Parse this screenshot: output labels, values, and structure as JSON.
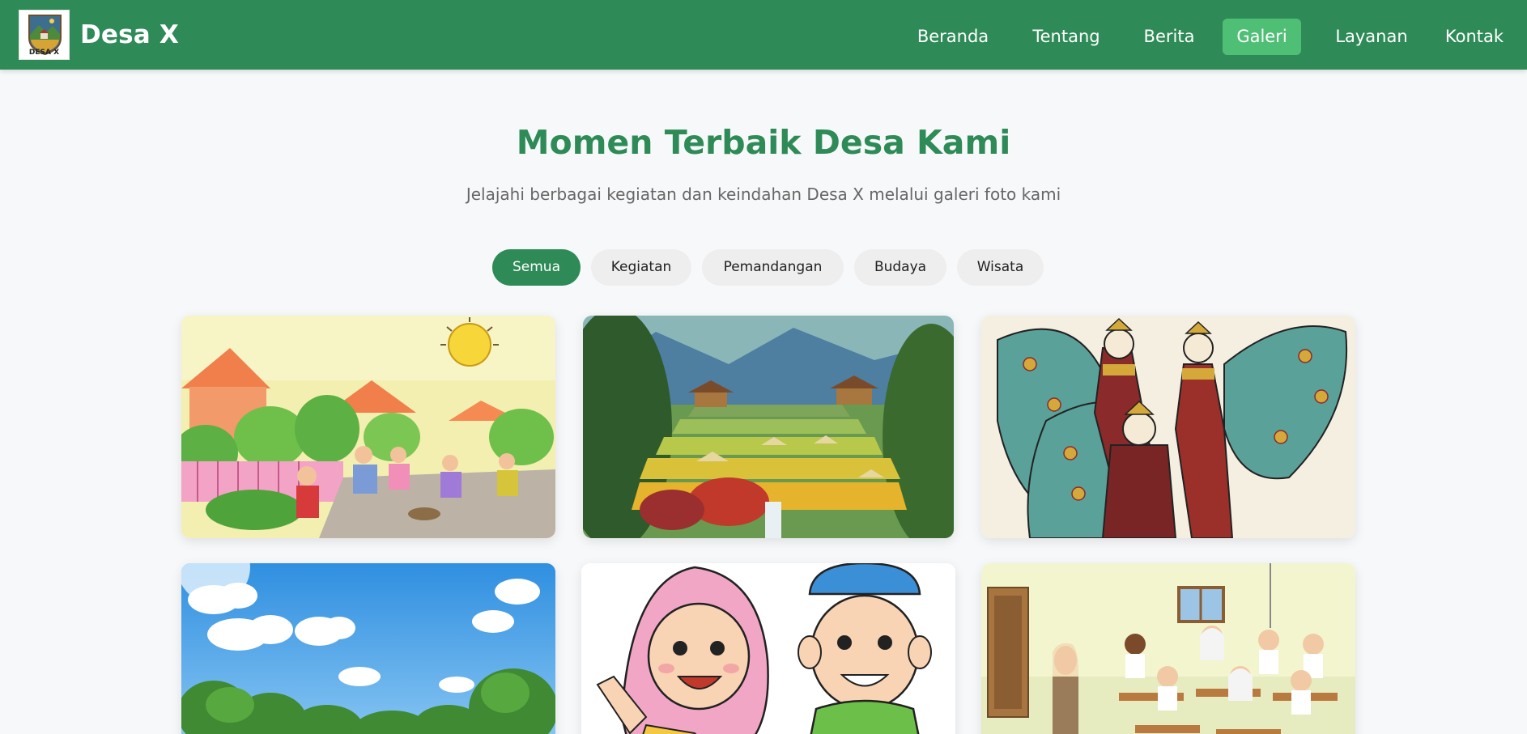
{
  "brand": {
    "name": "Desa X",
    "logo_text": "DESA X",
    "logo_icon": "village-shield-logo"
  },
  "nav": {
    "items": [
      {
        "label": "Beranda",
        "active": false
      },
      {
        "label": "Tentang",
        "active": false
      },
      {
        "label": "Berita",
        "active": false
      },
      {
        "label": "Galeri",
        "active": true
      },
      {
        "label": "Layanan",
        "active": false
      },
      {
        "label": "Kontak",
        "active": false
      }
    ]
  },
  "hero": {
    "title": "Momen Terbaik Desa Kami",
    "subtitle": "Jelajahi berbagai kegiatan dan keindahan Desa X melalui galeri foto kami"
  },
  "filters": [
    {
      "label": "Semua",
      "active": true
    },
    {
      "label": "Kegiatan",
      "active": false
    },
    {
      "label": "Pemandangan",
      "active": false
    },
    {
      "label": "Budaya",
      "active": false
    },
    {
      "label": "Wisata",
      "active": false
    }
  ],
  "gallery": [
    {
      "depicts": "gotong-royong-illustration"
    },
    {
      "depicts": "rice-terrace-painting"
    },
    {
      "depicts": "traditional-dance-illustration"
    },
    {
      "depicts": "blue-sky-trees-illustration"
    },
    {
      "depicts": "muslim-children-cartoon"
    },
    {
      "depicts": "classroom-illustration"
    }
  ],
  "colors": {
    "primary": "#2e8b57",
    "nav_active": "#4fbf75",
    "page_bg": "#f7f8fa",
    "filter_bg": "#eeeeee"
  }
}
